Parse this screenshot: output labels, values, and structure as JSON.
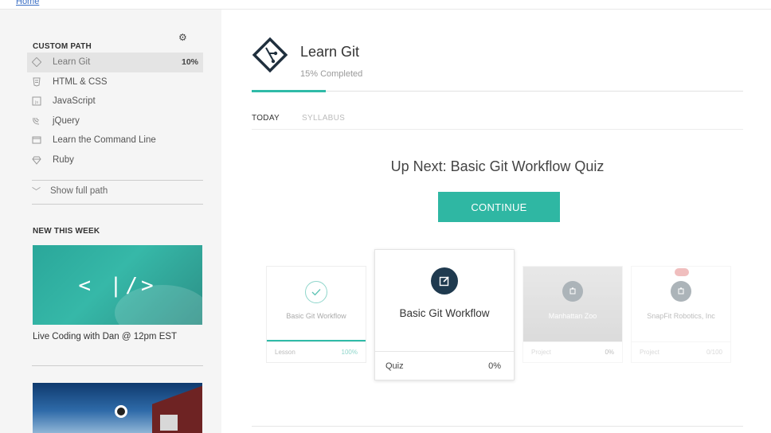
{
  "top_link": "Home",
  "sidebar": {
    "custom_path_title": "CUSTOM PATH",
    "items": [
      {
        "label": "Learn Git",
        "percent": "10%",
        "icon": "git-diamond-icon",
        "active": true
      },
      {
        "label": "HTML & CSS",
        "icon": "html-icon"
      },
      {
        "label": "JavaScript",
        "icon": "javascript-icon"
      },
      {
        "label": "jQuery",
        "icon": "jquery-icon"
      },
      {
        "label": "Learn the Command Line",
        "icon": "terminal-icon"
      },
      {
        "label": "Ruby",
        "icon": "ruby-icon"
      }
    ],
    "show_full_path": "Show full path",
    "new_this_week_title": "NEW THIS WEEK",
    "thumb1_code": "< |/>",
    "thumb1_caption": "Live Coding with Dan @ 12pm EST"
  },
  "course": {
    "title": "Learn Git",
    "completed": "15% Completed",
    "progress": 0.15
  },
  "tabs": [
    "TODAY",
    "SYLLABUS"
  ],
  "up_next": "Up Next: Basic Git Workflow Quiz",
  "continue_label": "CONTINUE",
  "cards": [
    {
      "name": "Basic Git Workflow",
      "type": "Lesson",
      "value": "100%",
      "progress": 1.0,
      "icon": "check-circle-icon"
    },
    {
      "name": "Basic Git Workflow",
      "type": "Quiz",
      "value": "0%",
      "icon": "edit-square-icon"
    },
    {
      "name": "Manhattan Zoo",
      "type": "Project",
      "value": "0%",
      "icon": "puzzle-icon"
    },
    {
      "name": "SnapFit Robotics, Inc",
      "type": "Project",
      "value": "0/100",
      "icon": "puzzle-icon"
    }
  ],
  "colors": {
    "accent": "#2fb7a3",
    "dark_icon": "#1f3a4f"
  }
}
